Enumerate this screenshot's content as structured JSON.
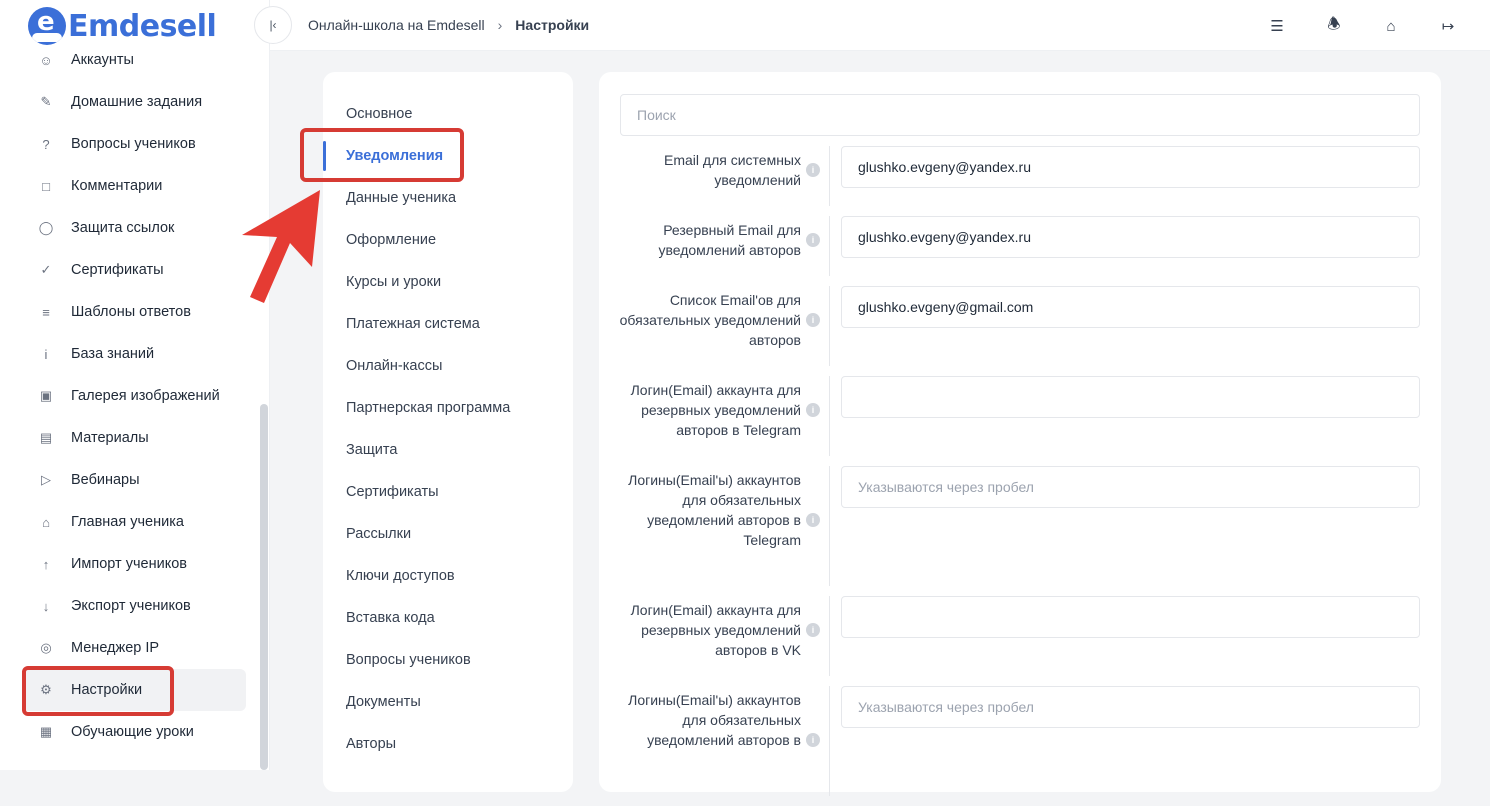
{
  "brand": {
    "name": "Emdesell",
    "logo_letter": "e"
  },
  "sidebar": {
    "items": [
      {
        "label": "Аккаунты",
        "icon": "users-icon"
      },
      {
        "label": "Домашние задания",
        "icon": "pencil-icon"
      },
      {
        "label": "Вопросы учеников",
        "icon": "question-icon"
      },
      {
        "label": "Комментарии",
        "icon": "comment-icon"
      },
      {
        "label": "Защита ссылок",
        "icon": "shield-icon"
      },
      {
        "label": "Сертификаты",
        "icon": "badge-check-icon"
      },
      {
        "label": "Шаблоны ответов",
        "icon": "list-icon"
      },
      {
        "label": "База знаний",
        "icon": "info-icon"
      },
      {
        "label": "Галерея изображений",
        "icon": "image-icon"
      },
      {
        "label": "Материалы",
        "icon": "briefcase-icon"
      },
      {
        "label": "Вебинары",
        "icon": "play-icon"
      },
      {
        "label": "Главная ученика",
        "icon": "home-icon"
      },
      {
        "label": "Импорт учеников",
        "icon": "upload-icon"
      },
      {
        "label": "Экспорт учеников",
        "icon": "download-icon"
      },
      {
        "label": "Менеджер IP",
        "icon": "target-icon"
      },
      {
        "label": "Настройки",
        "icon": "gear-icon",
        "active": true
      },
      {
        "label": "Обучающие уроки",
        "icon": "film-icon"
      }
    ]
  },
  "header": {
    "breadcrumb": [
      "Онлайн-школа на Emdesell",
      "Настройки"
    ],
    "icons": [
      "sliders-icon",
      "bell-icon",
      "home-gear-icon",
      "logout-icon"
    ]
  },
  "settings_menu": {
    "items": [
      "Основное",
      "Уведомления",
      "Данные ученика",
      "Оформление",
      "Курсы и уроки",
      "Платежная система",
      "Онлайн-кассы",
      "Партнерская программа",
      "Защита",
      "Сертификаты",
      "Рассылки",
      "Ключи доступов",
      "Вставка кода",
      "Вопросы учеников",
      "Документы",
      "Авторы"
    ],
    "active_index": 1
  },
  "form": {
    "search_placeholder": "Поиск",
    "fields": [
      {
        "label": "Email для системных уведомлений",
        "value": "glushko.evgeny@yandex.ru",
        "placeholder": ""
      },
      {
        "label": "Резервный Email для уведомлений авторов",
        "value": "glushko.evgeny@yandex.ru",
        "placeholder": ""
      },
      {
        "label": "Список Email'ов для обязательных уведомлений авторов",
        "value": "glushko.evgeny@gmail.com",
        "placeholder": ""
      },
      {
        "label": "Логин(Email) аккаунта для резервных уведомлений авторов в Telegram",
        "value": "",
        "placeholder": ""
      },
      {
        "label": "Логины(Email'ы) аккаунтов для обязательных уведомлений авторов в Telegram",
        "value": "",
        "placeholder": "Указываются через пробел"
      },
      {
        "label": "Логин(Email) аккаунта для резервных уведомлений авторов в VK",
        "value": "",
        "placeholder": ""
      },
      {
        "label": "Логины(Email'ы) аккаунтов для обязательных уведомлений авторов в",
        "value": "",
        "placeholder": "Указываются через пробел"
      }
    ]
  },
  "colors": {
    "accent": "#3b6fd8",
    "annotation": "#d63b34"
  }
}
